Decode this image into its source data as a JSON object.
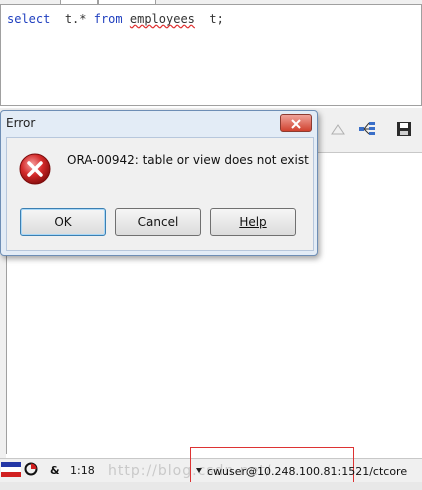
{
  "editor": {
    "sql_keyword_select": "select",
    "sql_alias_cols": "t.*",
    "sql_keyword_from": "from",
    "sql_table": "employees",
    "sql_alias": "t;"
  },
  "dialog": {
    "title": "Error",
    "message": "ORA-00942: table or view does not exist",
    "ok_label": "OK",
    "cancel_label": "Cancel",
    "help_label": "Help",
    "icon": "error-icon"
  },
  "statusbar": {
    "cursor_position": "1:18",
    "connection": "cwuser@10.248.100.81:1521/ctcore",
    "watermark": "http://blog.csdn.net/"
  },
  "colors": {
    "keyword": "#1f3fbf",
    "highlight_box": "#dd3333",
    "close_button": "#d0422f"
  }
}
